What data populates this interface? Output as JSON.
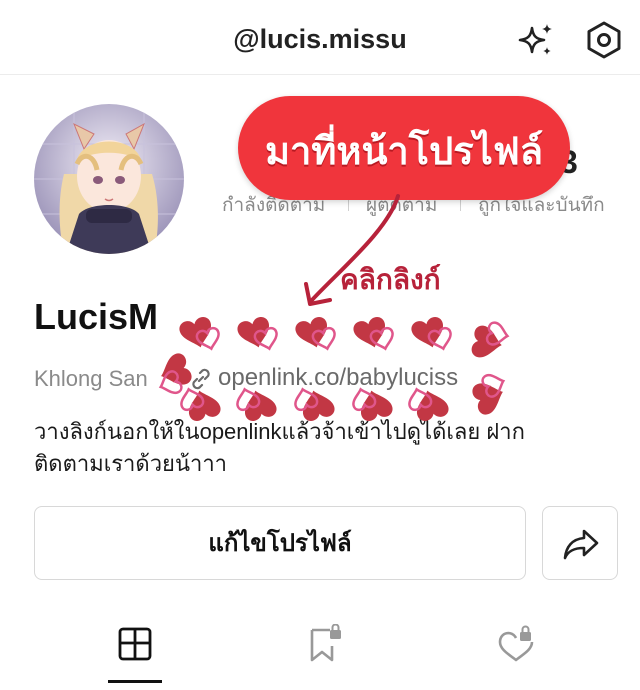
{
  "header": {
    "username": "@lucis.missu",
    "icons": [
      "sparkle-icon",
      "settings-icon"
    ]
  },
  "profile": {
    "avatar": "avatar",
    "display_name": "LucisM",
    "location": "Khlong San",
    "link": "openlink.co/babyluciss",
    "bio": "วางลิงก์นอกให้ในopenlinkแล้วจ้าเข้าไปดูได้เลย ฝากติดตามเราด้วยน้าาา"
  },
  "stats": {
    "following_label": "กำลังติดตาม",
    "followers_label": "ผู้ติดตาม",
    "likes_label": "ถูกใจและบันทึก",
    "visible_count": "3"
  },
  "overlay": {
    "bubble_text": "มาที่หน้าโปรไฟล์",
    "click_label": "คลิกลิงก์"
  },
  "actions": {
    "edit_profile": "แก้ไขโปรไฟล์",
    "share_icon": "share-icon"
  },
  "tabs": [
    "grid-icon",
    "bookmark-lock-icon",
    "heart-lock-icon"
  ],
  "colors": {
    "bubble": "#f0353c",
    "heart": "#c23744",
    "heart_accent": "#e0568b"
  }
}
